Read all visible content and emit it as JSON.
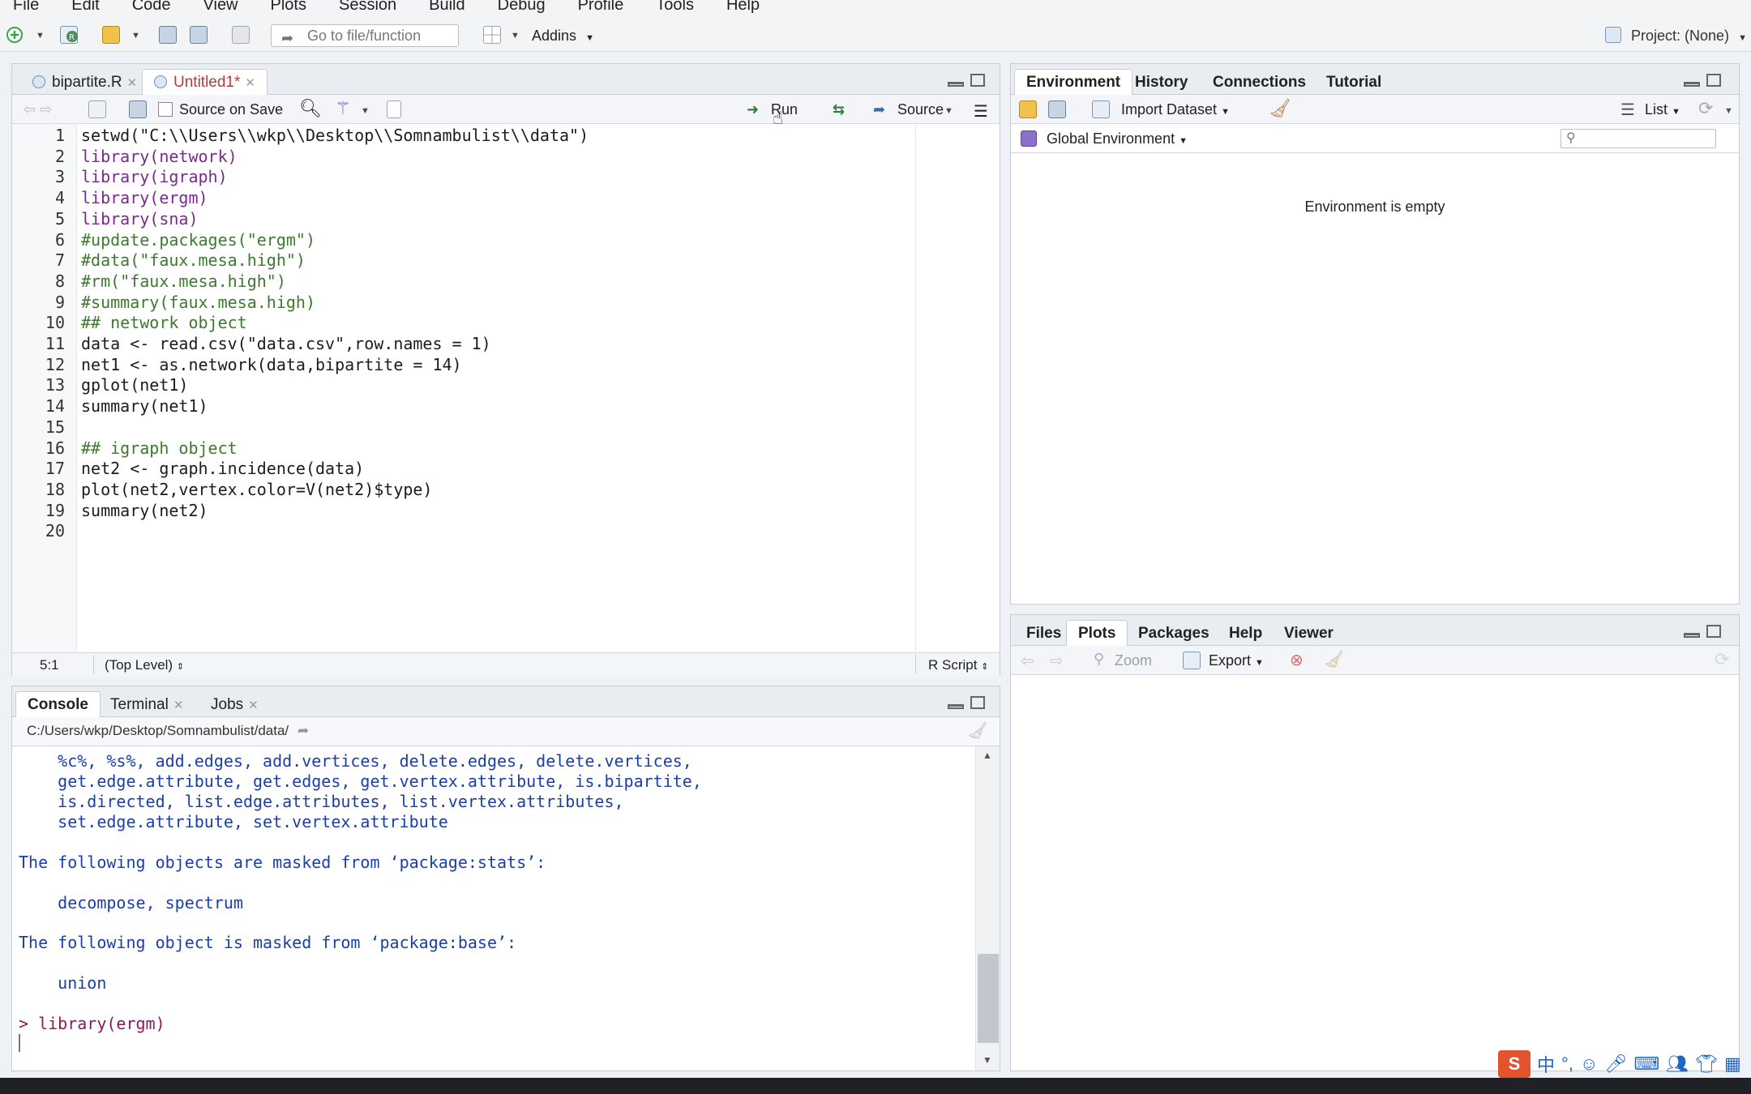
{
  "menu": [
    "File",
    "Edit",
    "Code",
    "View",
    "Plots",
    "Session",
    "Build",
    "Debug",
    "Profile",
    "Tools",
    "Help"
  ],
  "toolbar": {
    "goto_placeholder": "Go to file/function",
    "addins_label": "Addins",
    "project_label": "Project: (None)"
  },
  "source": {
    "tabs": [
      {
        "label": "bipartite.R",
        "active": false
      },
      {
        "label": "Untitled1*",
        "active": true
      }
    ],
    "source_on_save_label": "Source on Save",
    "run_label": "Run",
    "source_label": "Source",
    "lines": [
      "setwd(\"C:\\\\Users\\\\wkp\\\\Desktop\\\\Somnambulist\\\\data\")",
      "library(network)",
      "library(igraph)",
      "library(ergm)",
      "library(sna)",
      "#update.packages(\"ergm\")",
      "#data(\"faux.mesa.high\")",
      "#rm(\"faux.mesa.high\")",
      "#summary(faux.mesa.high)",
      "## network object",
      "data <- read.csv(\"data.csv\",row.names = 1)",
      "net1 <- as.network(data,bipartite = 14)",
      "gplot(net1)",
      "summary(net1)",
      "",
      "## igraph object",
      "net2 <- graph.incidence(data)",
      "plot(net2,vertex.color=V(net2)$type)",
      "summary(net2)",
      ""
    ],
    "line_numbers": [
      "1",
      "2",
      "3",
      "4",
      "5",
      "6",
      "7",
      "8",
      "9",
      "10",
      "11",
      "12",
      "13",
      "14",
      "15",
      "16",
      "17",
      "18",
      "19",
      "20"
    ],
    "status_position": "5:1",
    "status_scope": "(Top Level)",
    "status_filetype": "R Script"
  },
  "console": {
    "tabs": [
      {
        "label": "Console",
        "active": true
      },
      {
        "label": "Terminal",
        "active": false
      },
      {
        "label": "Jobs",
        "active": false
      }
    ],
    "path": "C:/Users/wkp/Desktop/Somnambulist/data/",
    "lines": [
      "    %c%, %s%, add.edges, add.vertices, delete.edges, delete.vertices,",
      "    get.edge.attribute, get.edges, get.vertex.attribute, is.bipartite,",
      "    is.directed, list.edge.attributes, list.vertex.attributes,",
      "    set.edge.attribute, set.vertex.attribute",
      "",
      "The following objects are masked from ‘package:stats’:",
      "",
      "    decompose, spectrum",
      "",
      "The following object is masked from ‘package:base’:",
      "",
      "    union",
      "",
      "> library(ergm)"
    ]
  },
  "environment": {
    "tabs": [
      {
        "label": "Environment",
        "active": true
      },
      {
        "label": "History",
        "active": false
      },
      {
        "label": "Connections",
        "active": false
      },
      {
        "label": "Tutorial",
        "active": false
      }
    ],
    "import_label": "Import Dataset",
    "list_label": "List",
    "global_env_label": "Global Environment",
    "empty_message": "Environment is empty"
  },
  "files": {
    "tabs": [
      {
        "label": "Files",
        "active": false
      },
      {
        "label": "Plots",
        "active": true
      },
      {
        "label": "Packages",
        "active": false
      },
      {
        "label": "Help",
        "active": false
      },
      {
        "label": "Viewer",
        "active": false
      }
    ],
    "zoom_label": "Zoom",
    "export_label": "Export"
  },
  "tray": {
    "ime_label": "中",
    "ime_punct": "°,"
  },
  "colors": {
    "keyword": "#7a2a8a",
    "string": "#1a5fb4",
    "comment": "#3c7a2e",
    "console_text": "#1a3fa8"
  }
}
